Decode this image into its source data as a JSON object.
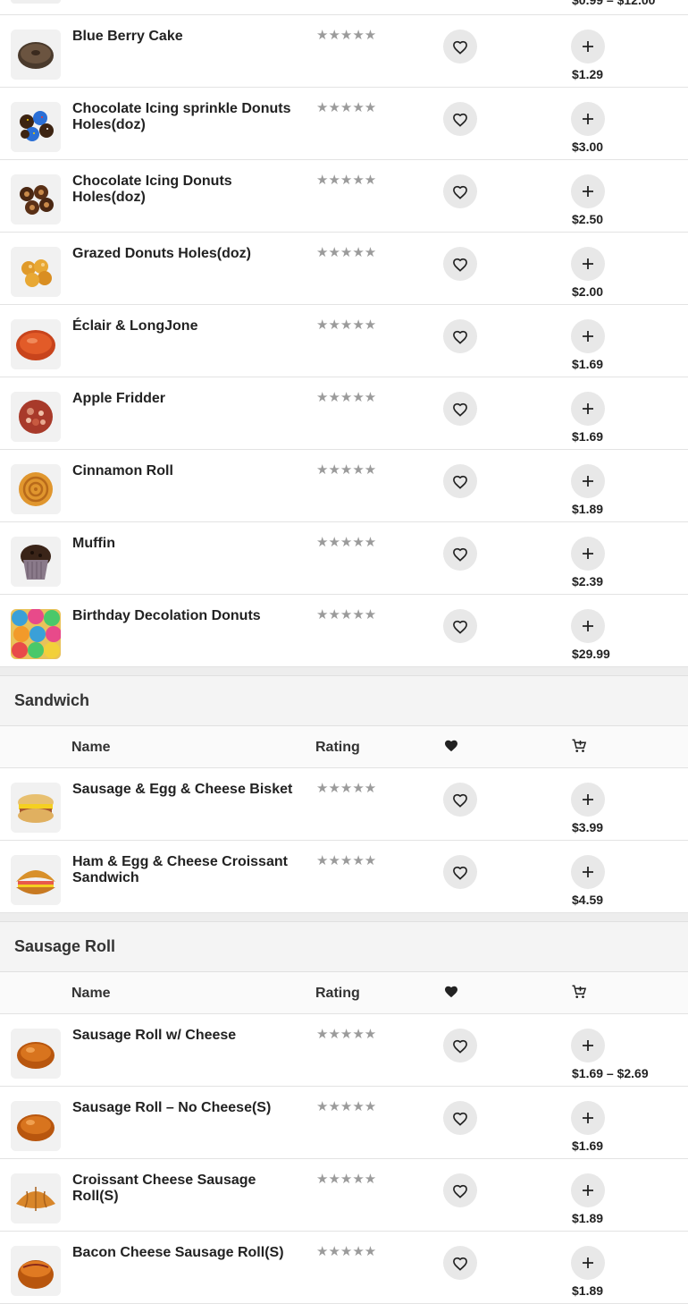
{
  "top_partial": {
    "price": "$0.99 – $12.00"
  },
  "sections": [
    {
      "title": "",
      "items": [
        {
          "name": "Blue Berry Cake",
          "price": "$1.29",
          "thumb": "blueberry-cake",
          "rating": "★★★★★"
        },
        {
          "name": "Chocolate Icing sprinkle Donuts Holes(doz)",
          "price": "$3.00",
          "thumb": "sprinkle-holes",
          "rating": "★★★★★"
        },
        {
          "name": "Chocolate Icing Donuts Holes(doz)",
          "price": "$2.50",
          "thumb": "choc-holes",
          "rating": "★★★★★"
        },
        {
          "name": "Grazed Donuts Holes(doz)",
          "price": "$2.00",
          "thumb": "glazed-holes",
          "rating": "★★★★★"
        },
        {
          "name": "Éclair & LongJone",
          "price": "$1.69",
          "thumb": "eclair",
          "rating": "★★★★★"
        },
        {
          "name": "Apple Fridder",
          "price": "$1.69",
          "thumb": "apple-fritter",
          "rating": "★★★★★"
        },
        {
          "name": "Cinnamon Roll",
          "price": "$1.89",
          "thumb": "cinnamon-roll",
          "rating": "★★★★★"
        },
        {
          "name": "Muffin",
          "price": "$2.39",
          "thumb": "muffin",
          "rating": "★★★★★"
        },
        {
          "name": "Birthday Decolation Donuts",
          "price": "$29.99",
          "thumb": "birthday-donuts",
          "rating": "★★★★★"
        }
      ]
    },
    {
      "title": "Sandwich",
      "columns": {
        "name": "Name",
        "rating": "Rating"
      },
      "items": [
        {
          "name": "Sausage & Egg & Cheese Bisket",
          "price": "$3.99",
          "thumb": "biscuit",
          "rating": "★★★★★"
        },
        {
          "name": "Ham & Egg & Cheese Croissant Sandwich",
          "price": "$4.59",
          "thumb": "croissant-sandwich",
          "rating": "★★★★★"
        }
      ]
    },
    {
      "title": "Sausage Roll",
      "columns": {
        "name": "Name",
        "rating": "Rating"
      },
      "items": [
        {
          "name": "Sausage Roll w/ Cheese",
          "price": "$1.69 – $2.69",
          "thumb": "sausage-roll",
          "rating": "★★★★★"
        },
        {
          "name": "Sausage Roll – No Cheese(S)",
          "price": "$1.69",
          "thumb": "sausage-roll",
          "rating": "★★★★★"
        },
        {
          "name": "Croissant Cheese Sausage Roll(S)",
          "price": "$1.89",
          "thumb": "croissant-roll",
          "rating": "★★★★★"
        },
        {
          "name": "Bacon Cheese Sausage Roll(S)",
          "price": "$1.89",
          "thumb": "bacon-roll",
          "rating": "★★★★★"
        }
      ]
    }
  ],
  "colors": {
    "star": "#9b9b9b",
    "button_bg": "#e8e8e8",
    "section_bg": "#f4f4f4"
  }
}
